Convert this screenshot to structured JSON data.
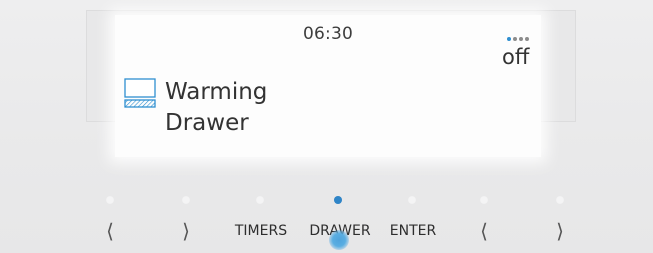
{
  "display": {
    "time": "06:30",
    "status": "off",
    "status_dots": {
      "active_color": "#2f8fd0",
      "count": 4,
      "active_index": 0
    },
    "program": {
      "line1": "Warming",
      "line2": "Drawer",
      "icon": "warming-drawer-icon"
    }
  },
  "controls": {
    "indicator_active_color": "#2f85c8",
    "buttons": [
      {
        "id": "left1",
        "label": "⟨",
        "icon": "chevron-left-icon",
        "active": false
      },
      {
        "id": "right1",
        "label": "⟩",
        "icon": "chevron-right-icon",
        "active": false
      },
      {
        "id": "timers",
        "label": "TIMERS",
        "active": false
      },
      {
        "id": "drawer",
        "label": "DRAWER",
        "active": true
      },
      {
        "id": "enter",
        "label": "ENTER",
        "active": false
      },
      {
        "id": "left2",
        "label": "⟨",
        "icon": "chevron-left-icon",
        "active": false
      },
      {
        "id": "right2",
        "label": "⟩",
        "icon": "chevron-right-icon",
        "active": false
      }
    ]
  }
}
